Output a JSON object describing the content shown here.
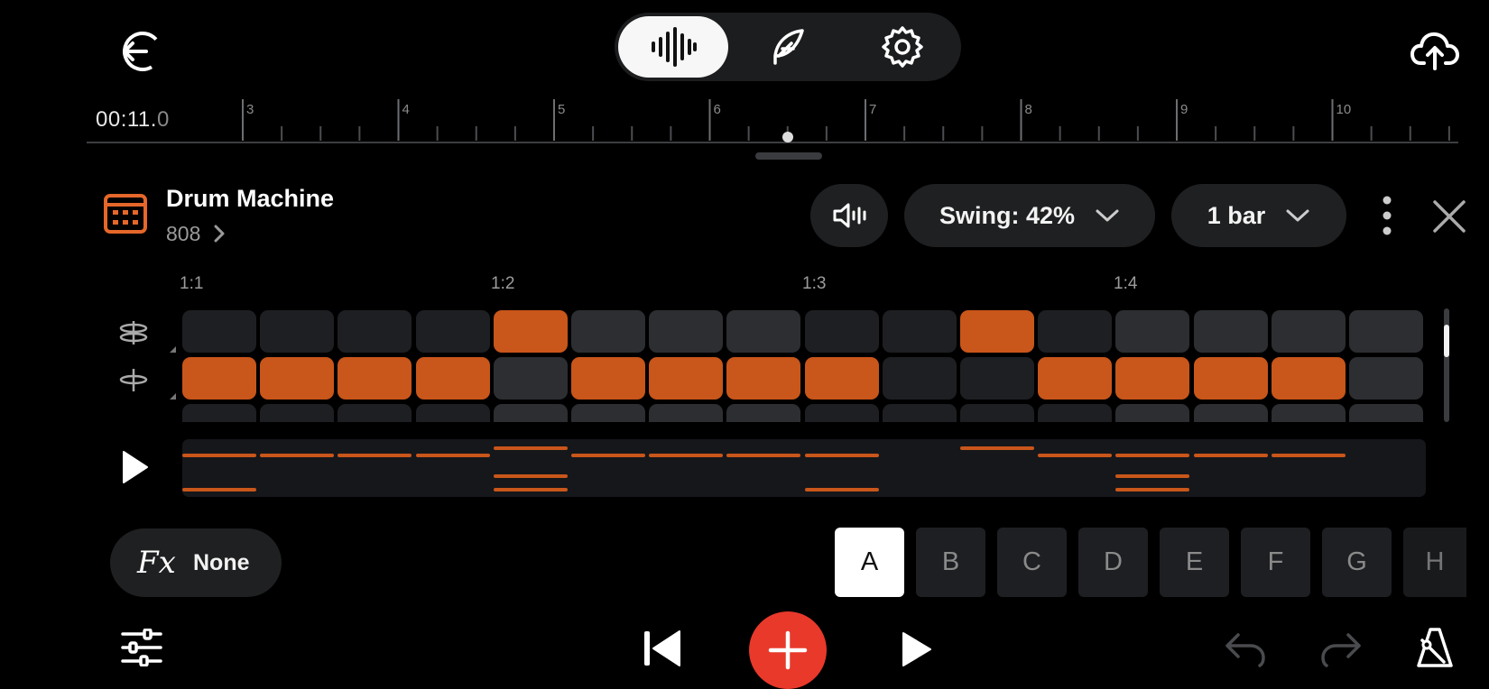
{
  "header": {
    "back_icon": "back-arrow-icon",
    "upload_icon": "cloud-upload-icon",
    "modes": [
      {
        "id": "waveform",
        "icon": "waveform-icon",
        "active": true
      },
      {
        "id": "feather",
        "icon": "feather-icon",
        "active": false
      },
      {
        "id": "settings",
        "icon": "gear-icon",
        "active": false
      }
    ]
  },
  "timeline": {
    "time_main": "00:11.",
    "time_frac": "0",
    "bar_numbers": [
      "3",
      "4",
      "5",
      "6",
      "7",
      "8",
      "9",
      "10"
    ]
  },
  "instrument": {
    "title": "Drum Machine",
    "kit": "808",
    "swing_label": "Swing: 42%",
    "length_label": "1 bar"
  },
  "sequencer": {
    "beat_labels": [
      "1:1",
      "1:2",
      "1:3",
      "1:4"
    ],
    "tracks": [
      {
        "icon": "hi-hat-open-icon",
        "steps": [
          0,
          0,
          0,
          0,
          1,
          0,
          0,
          0,
          0,
          0,
          1,
          0,
          0,
          0,
          0,
          0
        ]
      },
      {
        "icon": "hi-hat-closed-icon",
        "steps": [
          1,
          1,
          1,
          1,
          0,
          1,
          1,
          1,
          1,
          0,
          0,
          1,
          1,
          1,
          1,
          0
        ]
      }
    ],
    "overview_rows": [
      [
        0,
        0,
        0,
        0,
        1,
        0,
        0,
        0,
        0,
        0,
        1,
        0,
        0,
        0,
        0,
        0
      ],
      [
        1,
        1,
        1,
        1,
        0,
        1,
        1,
        1,
        1,
        0,
        0,
        1,
        1,
        1,
        1,
        0
      ],
      [
        0,
        0,
        0,
        0,
        1,
        0,
        0,
        0,
        0,
        0,
        0,
        0,
        1,
        0,
        0,
        0
      ],
      [
        1,
        0,
        0,
        0,
        1,
        0,
        0,
        0,
        1,
        0,
        0,
        0,
        1,
        0,
        0,
        0
      ]
    ]
  },
  "fx": {
    "label": "Fx",
    "value": "None"
  },
  "patterns": [
    "A",
    "B",
    "C",
    "D",
    "E",
    "F",
    "G",
    "H"
  ],
  "active_pattern": "A",
  "colors": {
    "accent": "#c9561a",
    "step_light": "#2c2e31",
    "step_dark": "#1e1f22",
    "record": "#e8392b",
    "brand_icon": "#e5672a"
  }
}
